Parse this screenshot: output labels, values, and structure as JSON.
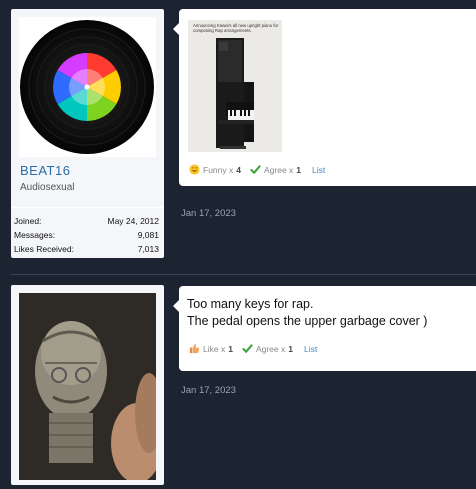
{
  "posts": [
    {
      "user": {
        "name": "BEAT16",
        "title": "Audiosexual",
        "stats": [
          {
            "label": "Joined:",
            "value": "May 24, 2012"
          },
          {
            "label": "Messages:",
            "value": "9,081"
          },
          {
            "label": "Likes Received:",
            "value": "7,013"
          }
        ]
      },
      "image_caption": "Announcing Kawai's all new upright piano for composing Rap arrangements.",
      "reactions": [
        {
          "icon": "funny-icon",
          "label": "Funny x",
          "count": "4"
        },
        {
          "icon": "agree-icon",
          "label": "Agree x",
          "count": "1"
        }
      ],
      "list_label": "List",
      "date": "Jan 17, 2023"
    },
    {
      "text_lines": [
        "Too many keys for rap.",
        "The pedal opens the upper garbage cover )"
      ],
      "reactions": [
        {
          "icon": "like-icon",
          "label": "Like x",
          "count": "1"
        },
        {
          "icon": "agree-icon",
          "label": "Agree x",
          "count": "1"
        }
      ],
      "list_label": "List",
      "date": "Jan 17, 2023"
    }
  ],
  "colors": {
    "background": "#1b2430",
    "username": "#2a6da8",
    "link": "#4a86c5"
  }
}
